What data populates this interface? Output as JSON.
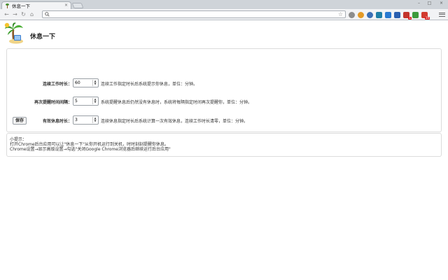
{
  "browser": {
    "tab_title": "休息一下",
    "tab_close": "×",
    "window_controls": {
      "minimize": "–",
      "maximize": "□",
      "close": "×"
    },
    "nav": {
      "back": "←",
      "forward": "→",
      "reload": "↻",
      "home": "⌂"
    },
    "omnibox": {
      "value": "",
      "placeholder": ""
    },
    "star": "☆",
    "extensions": [
      {
        "name": "puzzle-icon",
        "color": "#8d8d8d"
      },
      {
        "name": "orange-circle-icon",
        "color": "#e39a27"
      },
      {
        "name": "blue-globe-icon",
        "color": "#3b6fb6"
      },
      {
        "name": "teal-refresh-icon",
        "color": "#1f7fa7"
      },
      {
        "name": "blue-arrow-icon",
        "color": "#2a7ad1"
      },
      {
        "name": "blue-box-icon",
        "color": "#2a5fb0"
      },
      {
        "name": "red-book-icon",
        "color": "#c2342c",
        "badge": "1"
      },
      {
        "name": "green-leaf-icon",
        "color": "#3c9a3c"
      },
      {
        "name": "red-calendar-icon",
        "color": "#d13a2e",
        "badge": "19"
      }
    ]
  },
  "page": {
    "title": "休息一下",
    "settings": [
      {
        "label": "连续工作时长：",
        "value": "60",
        "desc": "连续工作指定时长后系统提示你休息，单位：分钟。"
      },
      {
        "label": "再次提醒时间间隔：",
        "value": "5",
        "desc": "系统提醒休息后仍然没有休息时，系统将每隔指定时间再次提醒你，单位：分钟。"
      },
      {
        "label": "有效休息时长：",
        "value": "3",
        "desc": "连续休息指定时长后系统计算一次有效休息，连续工作时长清零，单位：分钟。"
      }
    ],
    "save_label": "保存",
    "tips": {
      "title": "小提示：",
      "lines": [
        "打开Chrome后台应用可以让\"休息一下\"从你开机运行到关机，时时刻刻提醒你休息。",
        "Chrome设置→显示高级设置→勾选\"关闭Google Chrome浏览器后继续运行后台应用\""
      ]
    }
  }
}
